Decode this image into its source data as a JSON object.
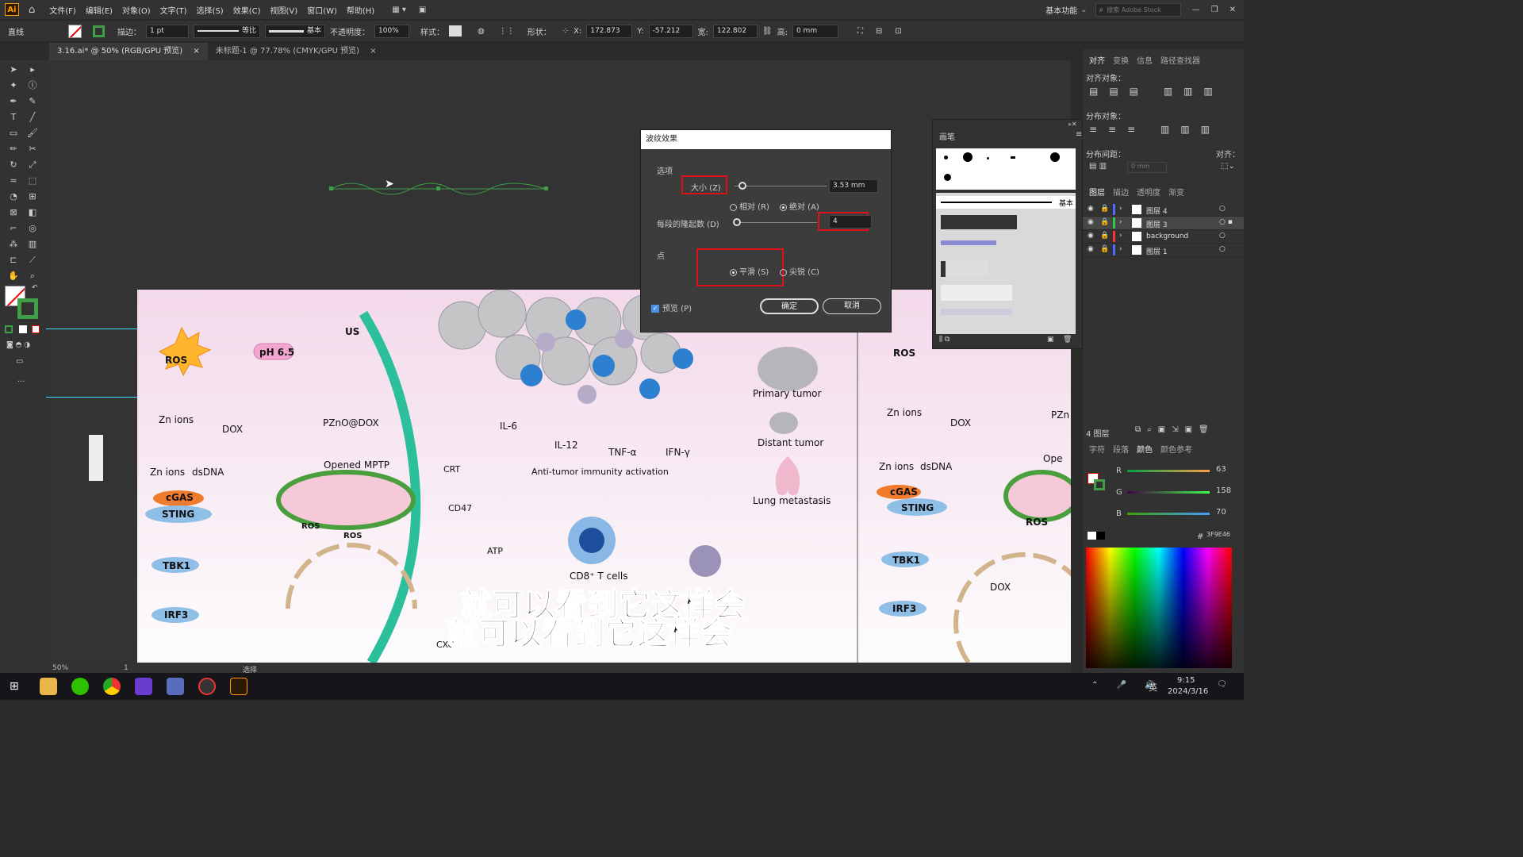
{
  "app": {
    "logo": "Ai",
    "workspace": "基本功能",
    "search_placeholder": "搜索 Adobe Stock"
  },
  "menu": [
    "文件(F)",
    "编辑(E)",
    "对象(O)",
    "文字(T)",
    "选择(S)",
    "效果(C)",
    "视图(V)",
    "窗口(W)",
    "帮助(H)"
  ],
  "control": {
    "object_type": "直线",
    "stroke_label": "描边：",
    "stroke_value": "1 pt",
    "profile": "等比",
    "brush": "基本",
    "opacity_label": "不透明度：",
    "opacity": "100%",
    "style_label": "样式：",
    "shape_label": "形状：",
    "x_label": "X:",
    "x": "172.873",
    "y_label": "Y:",
    "y": "-57.212",
    "w_label": "宽:",
    "w": "122.802",
    "h_label": "高:",
    "h": "0 mm"
  },
  "tabs": [
    {
      "label": "3.16.ai* @ 50% (RGB/GPU 预览)",
      "close": "×"
    },
    {
      "label": "未标题-1 @ 77.78% (CMYK/GPU 预览)",
      "close": "×"
    }
  ],
  "dialog": {
    "title": "波纹效果",
    "options_label": "选项",
    "size_label": "大小 (Z)",
    "size_value": "3.53 mm",
    "relative": "相对 (R)",
    "absolute": "绝对 (A)",
    "ridges_label": "每段的隆起数 (D)",
    "ridges_value": "4",
    "points_label": "点",
    "smooth": "平滑 (S)",
    "corner": "尖锐 (C)",
    "preview": "预览 (P)",
    "ok": "确定",
    "cancel": "取消"
  },
  "brush_panel": {
    "title": "画笔",
    "basic": "基本"
  },
  "align_panel": {
    "tabs": [
      "对齐",
      "变换",
      "信息",
      "路径查找器"
    ],
    "align_objects": "对齐对象：",
    "distribute_objects": "分布对象：",
    "distribute_spacing": "分布间距：",
    "align_to": "对齐：",
    "spacing_value": "0 mm"
  },
  "layers_panel": {
    "tabs": [
      "图层",
      "描边",
      "透明度",
      "渐变"
    ],
    "layers": [
      {
        "name": "图层 4",
        "color": "#4f6bff"
      },
      {
        "name": "图层 3",
        "color": "#2ecc40"
      },
      {
        "name": "background",
        "color": "#ff3030"
      },
      {
        "name": "图层 1",
        "color": "#4f6bff"
      }
    ],
    "count": "4 图层"
  },
  "color_panel": {
    "tabs": [
      "字符",
      "段落",
      "颜色",
      "颜色参考"
    ],
    "r_label": "R",
    "r": "63",
    "g_label": "G",
    "g": "158",
    "b_label": "B",
    "b": "70",
    "hex_label": "#",
    "hex": "3F9E46"
  },
  "status": {
    "zoom": "50%",
    "page": "1",
    "tool": "选择"
  },
  "figure": {
    "ros": "ROS",
    "ph": "pH 6.5",
    "us": "US",
    "dox": "DOX",
    "pzno": "PZnO@DOX",
    "zn_ions": "Zn ions",
    "zn_ions2": "Zn ions",
    "dsdna": "dsDNA",
    "cgas": "cGAS",
    "sting": "STING",
    "tbk1": "TBK1",
    "irf3": "IRF3",
    "mptp": "Opened MPTP",
    "crt": "CRT",
    "cd47": "CD47",
    "atp": "ATP",
    "il6": "IL-6",
    "il12": "IL-12",
    "tnf": "TNF-α",
    "ifn": "IFN-γ",
    "anti_tumor": "Anti-tumor immunity activation",
    "cd8": "CD8⁺ T cells",
    "primary": "Primary tumor",
    "distant": "Distant tumor",
    "lung": "Lung metastasis",
    "p": "P",
    "pzn": "PZn",
    "ope": "Ope",
    "cxc": "CXC"
  },
  "subtitle": {
    "line1": "就可以看到它这样会",
    "line2": "就可以看到它这样会"
  },
  "taskbar": {
    "ime": "英",
    "time": "9:15",
    "date": "2024/3/16"
  }
}
